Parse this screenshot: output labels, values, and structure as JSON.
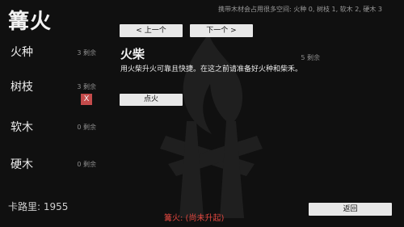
{
  "header": {
    "title": "篝火",
    "info": "携带木材会占用很多空间: 火种 0, 树枝 1, 软木 2, 硬木 3"
  },
  "materials": [
    {
      "name": "火种",
      "count": "3 剩余"
    },
    {
      "name": "树枝",
      "count": "3 剩余",
      "remove_label": "X"
    },
    {
      "name": "软木",
      "count": "0 剩余"
    },
    {
      "name": "硬木",
      "count": "0 剩余"
    }
  ],
  "calories": "卡路里: 1955",
  "nav": {
    "prev_label": "< 上一个",
    "next_label": "下一个 >"
  },
  "item": {
    "title": "火柴",
    "count": "5 剩余",
    "description": "用火柴升火可靠且快捷。在这之前请准备好火种和柴禾。",
    "action_label": "点火"
  },
  "status": "篝火: (尚未升起)",
  "back_label": "返回",
  "colors": {
    "status": "#e0473f",
    "remove_button": "#c44b4b",
    "button": "#e8e8e8"
  },
  "background_icon": "campfire-icon"
}
